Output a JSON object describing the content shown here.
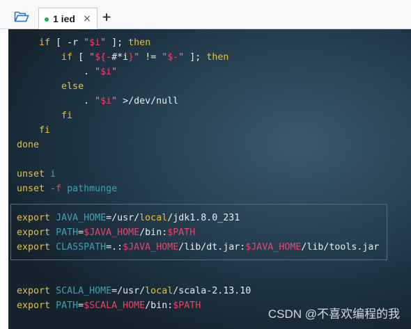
{
  "toolbar": {
    "folder_icon": "folder-open-icon",
    "icon_color": "#2f72c4"
  },
  "tabs": [
    {
      "label": "1 ied",
      "status_icon": "status-dot-icon",
      "status_color": "#22b14c",
      "close_label": "×",
      "close_icon": "close-icon"
    }
  ],
  "new_tab": {
    "label": "+",
    "icon": "plus-icon"
  },
  "syntax_colors": {
    "keyword": "#e3c04b",
    "identifier": "#41a0ad",
    "variable": "#e8446b",
    "string": "#e48595",
    "option": "#e35247",
    "plain": "#e9eef1"
  },
  "terminal": {
    "lines": [
      [
        {
          "t": "    ",
          "k": "plain"
        },
        {
          "t": "if",
          "k": "keyword"
        },
        {
          "t": " [ -r ",
          "k": "plain"
        },
        {
          "t": "\"",
          "k": "string"
        },
        {
          "t": "$i",
          "k": "variable"
        },
        {
          "t": "\"",
          "k": "string"
        },
        {
          "t": " ]; ",
          "k": "plain"
        },
        {
          "t": "then",
          "k": "keyword"
        }
      ],
      [
        {
          "t": "        ",
          "k": "plain"
        },
        {
          "t": "if",
          "k": "keyword"
        },
        {
          "t": " [ ",
          "k": "plain"
        },
        {
          "t": "\"",
          "k": "string"
        },
        {
          "t": "${-",
          "k": "variable"
        },
        {
          "t": "#*i",
          "k": "plain"
        },
        {
          "t": "}",
          "k": "variable"
        },
        {
          "t": "\"",
          "k": "string"
        },
        {
          "t": " != ",
          "k": "plain"
        },
        {
          "t": "\"",
          "k": "string"
        },
        {
          "t": "$-",
          "k": "variable"
        },
        {
          "t": "\"",
          "k": "string"
        },
        {
          "t": " ]; ",
          "k": "plain"
        },
        {
          "t": "then",
          "k": "keyword"
        }
      ],
      [
        {
          "t": "            . ",
          "k": "plain"
        },
        {
          "t": "\"",
          "k": "string"
        },
        {
          "t": "$i",
          "k": "variable"
        },
        {
          "t": "\"",
          "k": "string"
        }
      ],
      [
        {
          "t": "        ",
          "k": "plain"
        },
        {
          "t": "else",
          "k": "keyword"
        }
      ],
      [
        {
          "t": "            . ",
          "k": "plain"
        },
        {
          "t": "\"",
          "k": "string"
        },
        {
          "t": "$i",
          "k": "variable"
        },
        {
          "t": "\"",
          "k": "string"
        },
        {
          "t": " >/dev/null",
          "k": "plain"
        }
      ],
      [
        {
          "t": "        ",
          "k": "plain"
        },
        {
          "t": "fi",
          "k": "keyword"
        }
      ],
      [
        {
          "t": "    ",
          "k": "plain"
        },
        {
          "t": "fi",
          "k": "keyword"
        }
      ],
      [
        {
          "t": "done",
          "k": "keyword"
        }
      ],
      [],
      [
        {
          "t": "unset",
          "k": "keyword"
        },
        {
          "t": " ",
          "k": "plain"
        },
        {
          "t": "i",
          "k": "identifier"
        }
      ],
      [
        {
          "t": "unset",
          "k": "keyword"
        },
        {
          "t": " ",
          "k": "plain"
        },
        {
          "t": "-f",
          "k": "option"
        },
        {
          "t": " ",
          "k": "plain"
        },
        {
          "t": "pathmunge",
          "k": "identifier"
        }
      ],
      [],
      [
        {
          "t": "export",
          "k": "keyword"
        },
        {
          "t": " ",
          "k": "plain"
        },
        {
          "t": "JAVA_HOME",
          "k": "identifier"
        },
        {
          "t": "=/usr/",
          "k": "plain"
        },
        {
          "t": "local",
          "k": "keyword"
        },
        {
          "t": "/jdk1.8.0_231",
          "k": "plain"
        }
      ],
      [
        {
          "t": "export",
          "k": "keyword"
        },
        {
          "t": " ",
          "k": "plain"
        },
        {
          "t": "PATH",
          "k": "identifier"
        },
        {
          "t": "=",
          "k": "plain"
        },
        {
          "t": "$JAVA_HOME",
          "k": "variable"
        },
        {
          "t": "/bin:",
          "k": "plain"
        },
        {
          "t": "$PATH",
          "k": "variable"
        }
      ],
      [
        {
          "t": "export",
          "k": "keyword"
        },
        {
          "t": " ",
          "k": "plain"
        },
        {
          "t": "CLASSPATH",
          "k": "identifier"
        },
        {
          "t": "=.:",
          "k": "plain"
        },
        {
          "t": "$JAVA_HOME",
          "k": "variable"
        },
        {
          "t": "/lib/dt.jar:",
          "k": "plain"
        },
        {
          "t": "$JAVA_HOME",
          "k": "variable"
        },
        {
          "t": "/lib/tools.jar",
          "k": "plain"
        }
      ],
      [],
      [],
      [
        {
          "t": "export",
          "k": "keyword"
        },
        {
          "t": " ",
          "k": "plain"
        },
        {
          "t": "SCALA_HOME",
          "k": "identifier"
        },
        {
          "t": "=/usr/",
          "k": "plain"
        },
        {
          "t": "local",
          "k": "keyword"
        },
        {
          "t": "/scala-2.13.10",
          "k": "plain"
        }
      ],
      [
        {
          "t": "export",
          "k": "keyword"
        },
        {
          "t": " ",
          "k": "plain"
        },
        {
          "t": "PATH",
          "k": "identifier"
        },
        {
          "t": "=",
          "k": "plain"
        },
        {
          "t": "$SCALA_HOME",
          "k": "variable"
        },
        {
          "t": "/bin:",
          "k": "plain"
        },
        {
          "t": "$PATH",
          "k": "variable"
        }
      ]
    ]
  },
  "highlight_box": {
    "color": "#d8363d"
  },
  "watermark": "CSDN @不喜欢编程的我"
}
